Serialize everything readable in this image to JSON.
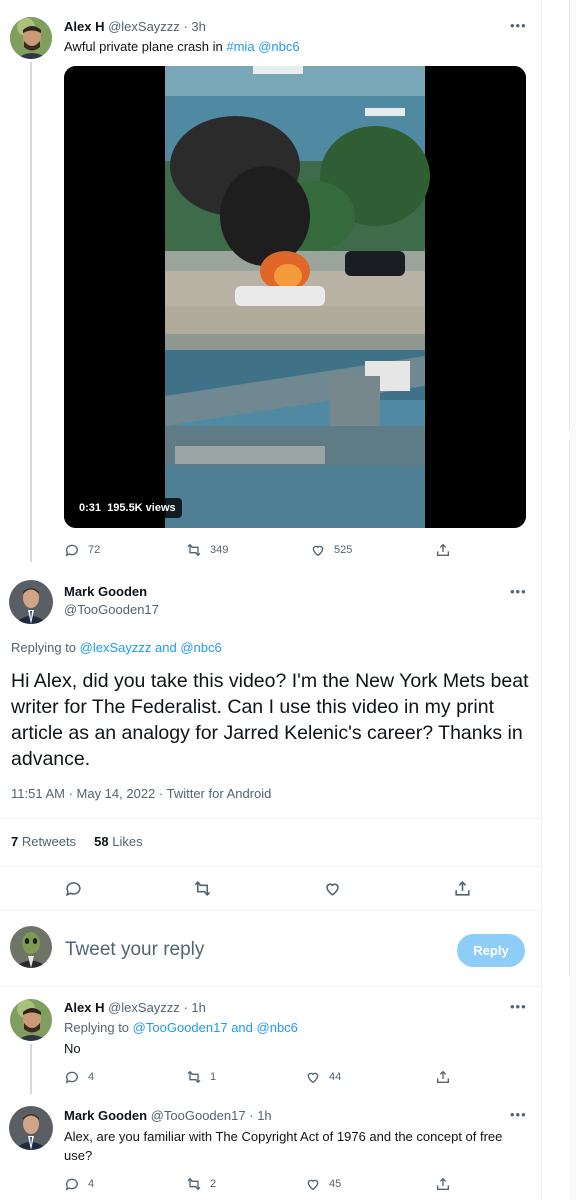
{
  "tweet1": {
    "name": "Alex H",
    "handle": "@lexSayzzz",
    "time": "3h",
    "text_prefix": "Awful private plane crash in",
    "hashtag": "#mia",
    "mention": "@nbc6",
    "video_duration": "0:31",
    "video_views": "195.5K views",
    "replies": "72",
    "retweets": "349",
    "likes": "525"
  },
  "main_tweet": {
    "name": "Mark Gooden",
    "handle": "@TooGooden17",
    "replying_label": "Replying to",
    "replying_mention1": "@lexSayzzz",
    "replying_and": "and",
    "replying_mention2": "@nbc6",
    "text": "Hi Alex, did you take this video? I'm the New York Mets beat writer for The Federalist. Can I use this video in my print article as an analogy for Jarred Kelenic's career? Thanks in advance.",
    "timestamp": "11:51 AM · May 14, 2022 · Twitter for Android",
    "retweets_count": "7",
    "retweets_label": "Retweets",
    "likes_count": "58",
    "likes_label": "Likes"
  },
  "compose": {
    "placeholder": "Tweet your reply",
    "button": "Reply"
  },
  "reply1": {
    "name": "Alex H",
    "handle": "@lexSayzzz",
    "time": "1h",
    "replying_label": "Replying to",
    "replying_mention1": "@TooGooden17",
    "replying_and": "and",
    "replying_mention2": "@nbc6",
    "text": "No",
    "replies": "4",
    "retweets": "1",
    "likes": "44"
  },
  "reply2": {
    "name": "Mark Gooden",
    "handle": "@TooGooden17",
    "time": "1h",
    "text": "Alex, are you familiar with The Copyright Act of 1976 and the concept of free use?",
    "replies": "4",
    "retweets": "2",
    "likes": "45"
  },
  "icons": [
    "reply-icon",
    "retweet-icon",
    "like-icon",
    "share-icon",
    "more-icon"
  ],
  "colors": {
    "link": "#1d9bf0",
    "secondary": "#536471",
    "reply_button": "#8ecdf8"
  }
}
